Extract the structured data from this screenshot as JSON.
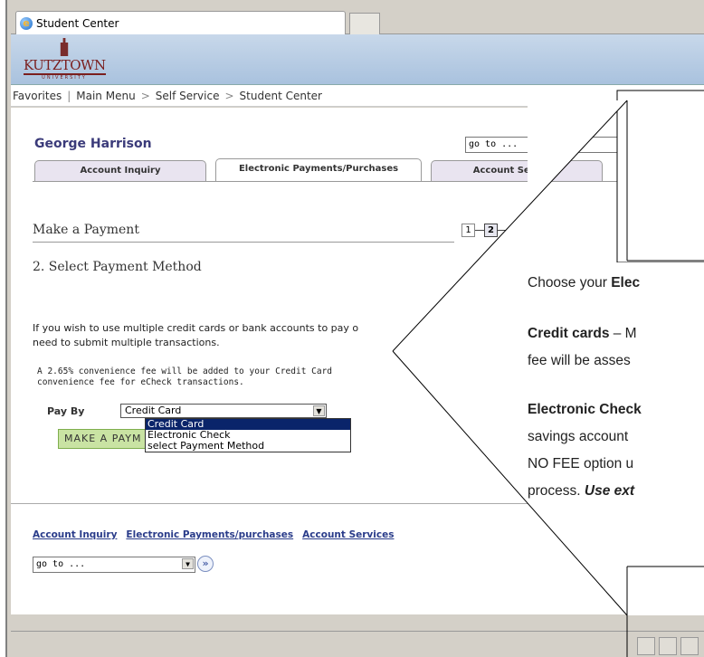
{
  "browser": {
    "tab_title": "Student Center"
  },
  "logo": {
    "name": "KUTZTOWN",
    "sub": "UNIVERSITY"
  },
  "nav": {
    "items": [
      "Favorites",
      "Main Menu",
      "Self Service",
      "Student Center"
    ]
  },
  "header": {
    "student_name": "George Harrison",
    "goto_placeholder": "go to ..."
  },
  "tabs": [
    {
      "label": "Account Inquiry"
    },
    {
      "label": "Electronic Payments/Purchases"
    },
    {
      "label": "Account Services"
    }
  ],
  "page": {
    "title": "Make a Payment",
    "subtitle": "2. Select Payment Method",
    "steps": [
      "1",
      "2"
    ],
    "intro_line1": "If you wish to use multiple credit cards or bank accounts to pay off y",
    "intro_line2": "need to submit multiple transactions.",
    "fee_line1": "A 2.65% convenience fee will be added to your Credit Card pay",
    "fee_line2": "convenience fee for eCheck transactions.",
    "pay_by_label": "Pay By",
    "pay_by_value": "Credit Card",
    "pay_by_options": [
      "Credit Card",
      "Electronic Check",
      "select Payment Method"
    ],
    "make_payment_button": "MAKE A PAYM"
  },
  "footer": {
    "links": [
      "Account Inquiry",
      "Electronic Payments/purchases",
      "Account Services"
    ],
    "goto_placeholder": "go to ..."
  },
  "callout": {
    "line1_prefix": "Choose your ",
    "line1_bold": "Elec",
    "line2_bold": "Credit cards",
    "line2_rest": " – M",
    "line3": "fee will be asses",
    "line4_bold": "Electronic Check",
    "line5": "savings account",
    "line6": "NO FEE option u",
    "line7_prefix": "process.  ",
    "line7_boldital": "Use ext"
  },
  "colors": {
    "banner": "#a9c2de",
    "name_color": "#3b3b7a",
    "link_color": "#2a3c8a",
    "make_payment_bg": "#c9e3a3",
    "selected_option_bg": "#0a246a"
  }
}
